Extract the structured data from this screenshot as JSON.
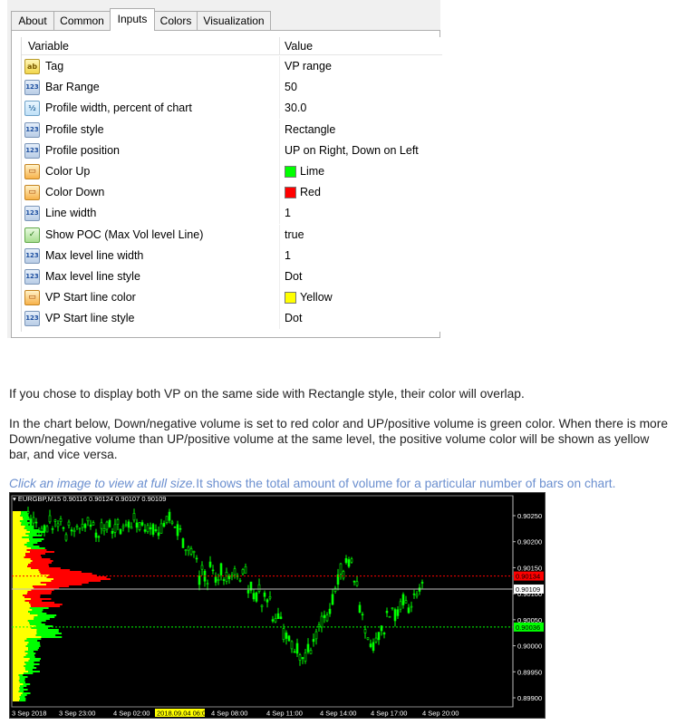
{
  "dialog": {
    "tabs": [
      {
        "label": "About",
        "active": false
      },
      {
        "label": "Common",
        "active": false
      },
      {
        "label": "Inputs",
        "active": true
      },
      {
        "label": "Colors",
        "active": false
      },
      {
        "label": "Visualization",
        "active": false
      }
    ],
    "grid": {
      "col_variable": "Variable",
      "col_value": "Value",
      "rows": [
        {
          "icon": "string-type-icon",
          "glyph": "ab",
          "name": "Tag",
          "value": "VP range"
        },
        {
          "icon": "integer-type-icon",
          "glyph": "123",
          "name": "Bar Range",
          "value": "50"
        },
        {
          "icon": "double-type-icon",
          "glyph": "½",
          "name": "Profile width, percent of chart",
          "value": "30.0"
        },
        {
          "icon": "integer-type-icon",
          "glyph": "123",
          "name": "Profile style",
          "value": "Rectangle"
        },
        {
          "icon": "integer-type-icon",
          "glyph": "123",
          "name": "Profile position",
          "value": "UP on Right, Down on Left"
        },
        {
          "icon": "color-type-icon",
          "glyph": "▭",
          "name": "Color Up",
          "value": "Lime",
          "swatch": "#00ff00"
        },
        {
          "icon": "color-type-icon",
          "glyph": "▭",
          "name": "Color Down",
          "value": "Red",
          "swatch": "#ff0000"
        },
        {
          "icon": "integer-type-icon",
          "glyph": "123",
          "name": "Line width",
          "value": "1"
        },
        {
          "icon": "bool-type-icon",
          "glyph": "✓",
          "name": "Show POC (Max Vol level Line)",
          "value": "true"
        },
        {
          "icon": "integer-type-icon",
          "glyph": "123",
          "name": "Max level line width",
          "value": "1"
        },
        {
          "icon": "integer-type-icon",
          "glyph": "123",
          "name": "Max level line style",
          "value": "Dot"
        },
        {
          "icon": "color-type-icon",
          "glyph": "▭",
          "name": "VP Start line color",
          "value": "Yellow",
          "swatch": "#ffff00"
        },
        {
          "icon": "integer-type-icon",
          "glyph": "123",
          "name": "VP Start line style",
          "value": "Dot"
        }
      ]
    }
  },
  "text": {
    "p1": "If you chose to display both VP on the same side with Rectangle style, their color will overlap.",
    "p2": "In the chart below, Down/negative volume is set to red color and UP/positive volume is green color. When there is more Down/negative volume than UP/positive volume at the same level, the positive volume color will be shown as yellow bar, and vice versa.",
    "p3_italic": "Click an image to view at full size.",
    "p3_rest": "It shows the total amount of volume for a particular number of bars on chart."
  },
  "chart": {
    "header": "▾ EURGBP,M15  0.90116 0.90124 0.90107 0.90109",
    "price_labels": [
      "0.90250",
      "0.90200",
      "0.90150",
      "0.90100",
      "0.90050",
      "0.90000",
      "0.89950",
      "0.89900"
    ],
    "price_values": [
      0.9025,
      0.902,
      0.9015,
      0.901,
      0.9005,
      0.9,
      0.8995,
      0.899
    ],
    "time_labels": [
      "3 Sep 2018",
      "3 Sep 23:00",
      "4 Sep 02:00",
      "2018.09.04 06:00",
      "4 Sep 08:00",
      "4 Sep 11:00",
      "4 Sep 14:00",
      "4 Sep 17:00",
      "4 Sep 20:00"
    ],
    "markers": [
      {
        "label": "0.90134",
        "price": 0.90134,
        "color": "#ff0000"
      },
      {
        "label": "0.90109",
        "price": 0.90109,
        "color": "#c0c0c0"
      },
      {
        "label": "0.90036",
        "price": 0.90036,
        "color": "#00ff00"
      }
    ],
    "colors": {
      "up": "#00ff00",
      "down": "#ff0000",
      "overlap": "#ffff00",
      "candle": "#00ff00",
      "background": "#000000"
    }
  }
}
